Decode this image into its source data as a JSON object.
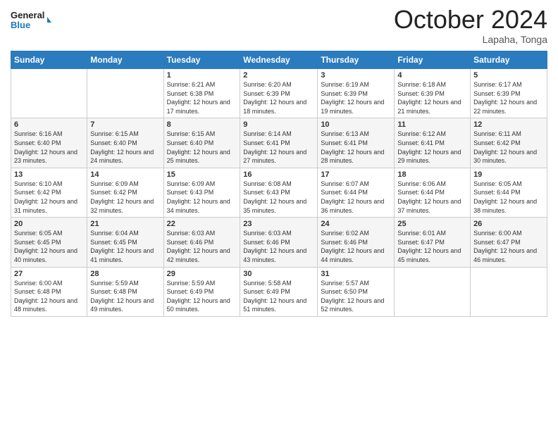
{
  "header": {
    "logo_line1": "General",
    "logo_line2": "Blue",
    "month": "October 2024",
    "location": "Lapaha, Tonga"
  },
  "weekdays": [
    "Sunday",
    "Monday",
    "Tuesday",
    "Wednesday",
    "Thursday",
    "Friday",
    "Saturday"
  ],
  "weeks": [
    [
      {
        "day": "",
        "info": ""
      },
      {
        "day": "",
        "info": ""
      },
      {
        "day": "1",
        "info": "Sunrise: 6:21 AM\nSunset: 6:38 PM\nDaylight: 12 hours and 17 minutes."
      },
      {
        "day": "2",
        "info": "Sunrise: 6:20 AM\nSunset: 6:39 PM\nDaylight: 12 hours and 18 minutes."
      },
      {
        "day": "3",
        "info": "Sunrise: 6:19 AM\nSunset: 6:39 PM\nDaylight: 12 hours and 19 minutes."
      },
      {
        "day": "4",
        "info": "Sunrise: 6:18 AM\nSunset: 6:39 PM\nDaylight: 12 hours and 21 minutes."
      },
      {
        "day": "5",
        "info": "Sunrise: 6:17 AM\nSunset: 6:39 PM\nDaylight: 12 hours and 22 minutes."
      }
    ],
    [
      {
        "day": "6",
        "info": "Sunrise: 6:16 AM\nSunset: 6:40 PM\nDaylight: 12 hours and 23 minutes."
      },
      {
        "day": "7",
        "info": "Sunrise: 6:15 AM\nSunset: 6:40 PM\nDaylight: 12 hours and 24 minutes."
      },
      {
        "day": "8",
        "info": "Sunrise: 6:15 AM\nSunset: 6:40 PM\nDaylight: 12 hours and 25 minutes."
      },
      {
        "day": "9",
        "info": "Sunrise: 6:14 AM\nSunset: 6:41 PM\nDaylight: 12 hours and 27 minutes."
      },
      {
        "day": "10",
        "info": "Sunrise: 6:13 AM\nSunset: 6:41 PM\nDaylight: 12 hours and 28 minutes."
      },
      {
        "day": "11",
        "info": "Sunrise: 6:12 AM\nSunset: 6:41 PM\nDaylight: 12 hours and 29 minutes."
      },
      {
        "day": "12",
        "info": "Sunrise: 6:11 AM\nSunset: 6:42 PM\nDaylight: 12 hours and 30 minutes."
      }
    ],
    [
      {
        "day": "13",
        "info": "Sunrise: 6:10 AM\nSunset: 6:42 PM\nDaylight: 12 hours and 31 minutes."
      },
      {
        "day": "14",
        "info": "Sunrise: 6:09 AM\nSunset: 6:42 PM\nDaylight: 12 hours and 32 minutes."
      },
      {
        "day": "15",
        "info": "Sunrise: 6:09 AM\nSunset: 6:43 PM\nDaylight: 12 hours and 34 minutes."
      },
      {
        "day": "16",
        "info": "Sunrise: 6:08 AM\nSunset: 6:43 PM\nDaylight: 12 hours and 35 minutes."
      },
      {
        "day": "17",
        "info": "Sunrise: 6:07 AM\nSunset: 6:44 PM\nDaylight: 12 hours and 36 minutes."
      },
      {
        "day": "18",
        "info": "Sunrise: 6:06 AM\nSunset: 6:44 PM\nDaylight: 12 hours and 37 minutes."
      },
      {
        "day": "19",
        "info": "Sunrise: 6:05 AM\nSunset: 6:44 PM\nDaylight: 12 hours and 38 minutes."
      }
    ],
    [
      {
        "day": "20",
        "info": "Sunrise: 6:05 AM\nSunset: 6:45 PM\nDaylight: 12 hours and 40 minutes."
      },
      {
        "day": "21",
        "info": "Sunrise: 6:04 AM\nSunset: 6:45 PM\nDaylight: 12 hours and 41 minutes."
      },
      {
        "day": "22",
        "info": "Sunrise: 6:03 AM\nSunset: 6:46 PM\nDaylight: 12 hours and 42 minutes."
      },
      {
        "day": "23",
        "info": "Sunrise: 6:03 AM\nSunset: 6:46 PM\nDaylight: 12 hours and 43 minutes."
      },
      {
        "day": "24",
        "info": "Sunrise: 6:02 AM\nSunset: 6:46 PM\nDaylight: 12 hours and 44 minutes."
      },
      {
        "day": "25",
        "info": "Sunrise: 6:01 AM\nSunset: 6:47 PM\nDaylight: 12 hours and 45 minutes."
      },
      {
        "day": "26",
        "info": "Sunrise: 6:00 AM\nSunset: 6:47 PM\nDaylight: 12 hours and 46 minutes."
      }
    ],
    [
      {
        "day": "27",
        "info": "Sunrise: 6:00 AM\nSunset: 6:48 PM\nDaylight: 12 hours and 48 minutes."
      },
      {
        "day": "28",
        "info": "Sunrise: 5:59 AM\nSunset: 6:48 PM\nDaylight: 12 hours and 49 minutes."
      },
      {
        "day": "29",
        "info": "Sunrise: 5:59 AM\nSunset: 6:49 PM\nDaylight: 12 hours and 50 minutes."
      },
      {
        "day": "30",
        "info": "Sunrise: 5:58 AM\nSunset: 6:49 PM\nDaylight: 12 hours and 51 minutes."
      },
      {
        "day": "31",
        "info": "Sunrise: 5:57 AM\nSunset: 6:50 PM\nDaylight: 12 hours and 52 minutes."
      },
      {
        "day": "",
        "info": ""
      },
      {
        "day": "",
        "info": ""
      }
    ]
  ]
}
